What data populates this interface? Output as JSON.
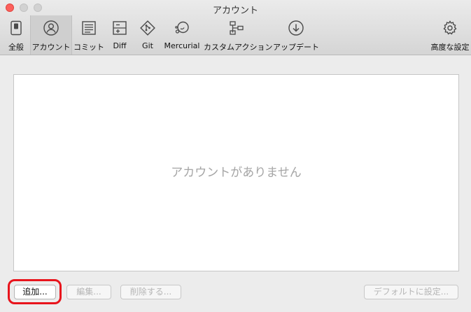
{
  "window": {
    "title": "アカウント"
  },
  "toolbar": {
    "items": [
      {
        "label": "全般",
        "icon": "general-switch-icon",
        "active": false
      },
      {
        "label": "アカウント",
        "icon": "account-person-icon",
        "active": true
      },
      {
        "label": "コミット",
        "icon": "commit-document-icon",
        "active": false
      },
      {
        "label": "Diff",
        "icon": "diff-icon",
        "active": false
      },
      {
        "label": "Git",
        "icon": "git-icon",
        "active": false
      },
      {
        "label": "Mercurial",
        "icon": "mercurial-icon",
        "active": false
      },
      {
        "label": "カスタムアクション",
        "icon": "custom-action-icon",
        "active": false
      },
      {
        "label": "アップデート",
        "icon": "update-download-icon",
        "active": false
      },
      {
        "label": "高度な設定",
        "icon": "gear-icon",
        "active": false
      }
    ]
  },
  "accounts": {
    "empty_message": "アカウントがありません"
  },
  "buttons": {
    "add": "追加...",
    "edit": "編集...",
    "remove": "削除する...",
    "set_default": "デフォルトに設定..."
  },
  "colors": {
    "highlight": "#e8141c",
    "close_button": "#fc605c"
  }
}
